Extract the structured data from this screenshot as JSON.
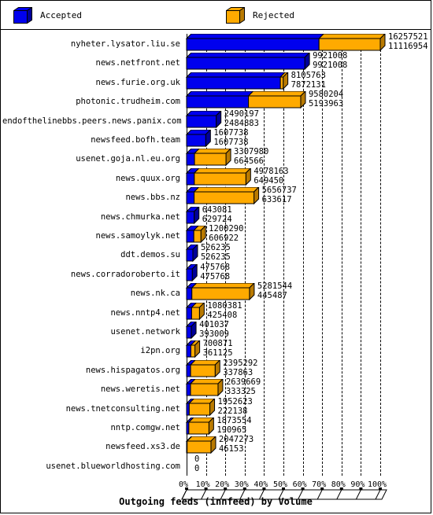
{
  "legend": {
    "items": [
      {
        "label": "Accepted",
        "color": "#0000ee",
        "side_color": "#000099",
        "icon": "cube-icon"
      },
      {
        "label": "Rejected",
        "color": "#ffaa00",
        "side_color": "#b97a00",
        "icon": "cube-icon"
      }
    ]
  },
  "title": "Outgoing feeds (innfeed) by Volume",
  "chart_data": {
    "type": "bar",
    "orientation": "horizontal-stacked",
    "title": "Outgoing feeds (innfeed) by Volume",
    "xlabel": "",
    "ylabel": "",
    "xlim": [
      0,
      100
    ],
    "x_unit": "percent",
    "grid": true,
    "legend_position": "top",
    "xticks": [
      "0%",
      "10%",
      "20%",
      "30%",
      "40%",
      "50%",
      "60%",
      "70%",
      "80%",
      "90%",
      "100%"
    ],
    "xtick_values": [
      0,
      10,
      20,
      30,
      40,
      50,
      60,
      70,
      80,
      90,
      100
    ],
    "scale_max": 16257521,
    "series": [
      {
        "name": "Accepted",
        "color": "#0000ee"
      },
      {
        "name": "Rejected",
        "color": "#ffaa00"
      }
    ],
    "categories": [
      "nyheter.lysator.liu.se",
      "news.netfront.net",
      "news.furie.org.uk",
      "photonic.trudheim.com",
      "endofthelinebbs.peers.news.panix.com",
      "newsfeed.bofh.team",
      "usenet.goja.nl.eu.org",
      "news.quux.org",
      "news.bbs.nz",
      "news.chmurka.net",
      "news.samoylyk.net",
      "ddt.demos.su",
      "news.corradoroberto.it",
      "news.nk.ca",
      "news.nntp4.net",
      "usenet.network",
      "i2pn.org",
      "news.hispagatos.org",
      "news.weretis.net",
      "news.tnetconsulting.net",
      "nntp.comgw.net",
      "newsfeed.xs3.de",
      "usenet.blueworldhosting.com"
    ],
    "rows": [
      {
        "label": "nyheter.lysator.liu.se",
        "total": 16257521,
        "accepted": 11116954,
        "rejected": 5140567
      },
      {
        "label": "news.netfront.net",
        "total": 9921008,
        "accepted": 9921008,
        "rejected": 0
      },
      {
        "label": "news.furie.org.uk",
        "total": 8105763,
        "accepted": 7872131,
        "rejected": 233632
      },
      {
        "label": "photonic.trudheim.com",
        "total": 9580204,
        "accepted": 5193963,
        "rejected": 4386241
      },
      {
        "label": "endofthelinebbs.peers.news.panix.com",
        "total": 2490197,
        "accepted": 2484883,
        "rejected": 5314
      },
      {
        "label": "newsfeed.bofh.team",
        "total": 1607738,
        "accepted": 1607738,
        "rejected": 0
      },
      {
        "label": "usenet.goja.nl.eu.org",
        "total": 3307980,
        "accepted": 664566,
        "rejected": 2643414
      },
      {
        "label": "news.quux.org",
        "total": 4978163,
        "accepted": 649450,
        "rejected": 4328713
      },
      {
        "label": "news.bbs.nz",
        "total": 5656737,
        "accepted": 633617,
        "rejected": 5023120
      },
      {
        "label": "news.chmurka.net",
        "total": 643081,
        "accepted": 629724,
        "rejected": 13357
      },
      {
        "label": "news.samoylyk.net",
        "total": 1200290,
        "accepted": 606922,
        "rejected": 593368
      },
      {
        "label": "ddt.demos.su",
        "total": 526235,
        "accepted": 526235,
        "rejected": 0
      },
      {
        "label": "news.corradoroberto.it",
        "total": 475768,
        "accepted": 475768,
        "rejected": 0
      },
      {
        "label": "news.nk.ca",
        "total": 5281544,
        "accepted": 445487,
        "rejected": 4836057
      },
      {
        "label": "news.nntp4.net",
        "total": 1080381,
        "accepted": 425408,
        "rejected": 654973
      },
      {
        "label": "usenet.network",
        "total": 401037,
        "accepted": 393009,
        "rejected": 8028
      },
      {
        "label": "i2pn.org",
        "total": 700871,
        "accepted": 361125,
        "rejected": 339746
      },
      {
        "label": "news.hispagatos.org",
        "total": 2395292,
        "accepted": 337863,
        "rejected": 2057429
      },
      {
        "label": "news.weretis.net",
        "total": 2639669,
        "accepted": 333325,
        "rejected": 2306344
      },
      {
        "label": "news.tnetconsulting.net",
        "total": 1952623,
        "accepted": 222138,
        "rejected": 1730485
      },
      {
        "label": "nntp.comgw.net",
        "total": 1873554,
        "accepted": 190965,
        "rejected": 1682589
      },
      {
        "label": "newsfeed.xs3.de",
        "total": 2047273,
        "accepted": 46153,
        "rejected": 2001120
      },
      {
        "label": "usenet.blueworldhosting.com",
        "total": 0,
        "accepted": 0,
        "rejected": 0
      }
    ]
  }
}
